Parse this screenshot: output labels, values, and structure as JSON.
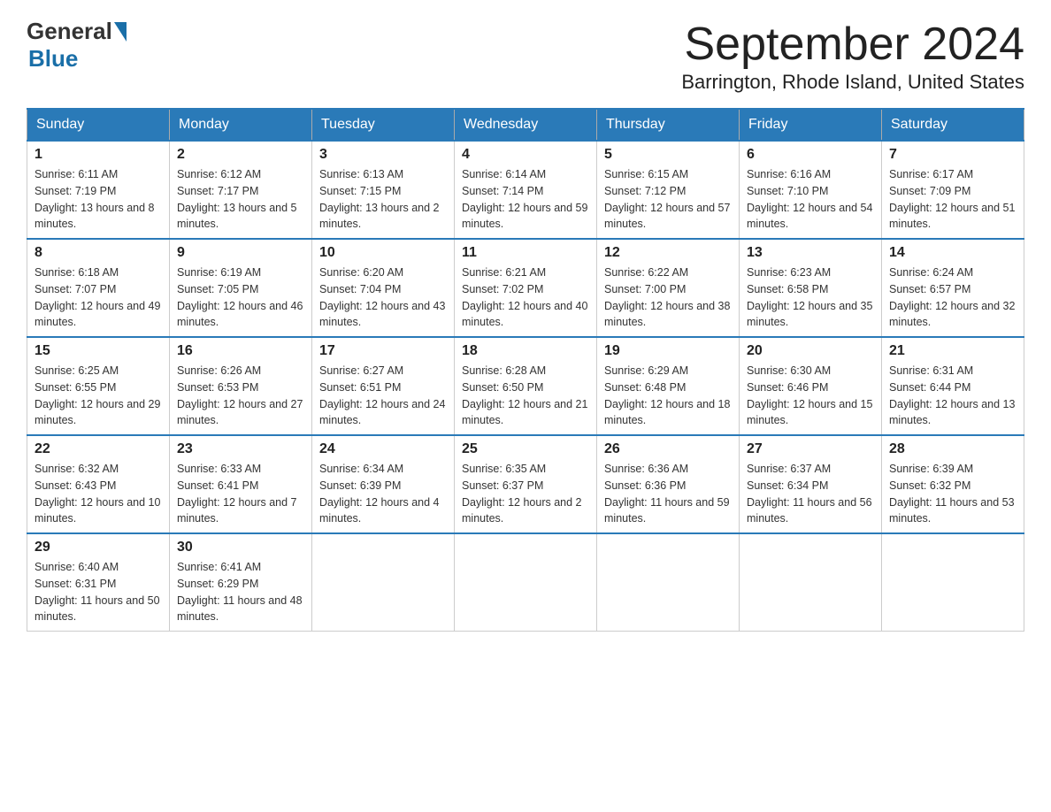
{
  "header": {
    "logo_general": "General",
    "logo_blue": "Blue",
    "month": "September 2024",
    "location": "Barrington, Rhode Island, United States"
  },
  "days_of_week": [
    "Sunday",
    "Monday",
    "Tuesday",
    "Wednesday",
    "Thursday",
    "Friday",
    "Saturday"
  ],
  "weeks": [
    [
      {
        "day": "1",
        "sunrise": "6:11 AM",
        "sunset": "7:19 PM",
        "daylight": "13 hours and 8 minutes."
      },
      {
        "day": "2",
        "sunrise": "6:12 AM",
        "sunset": "7:17 PM",
        "daylight": "13 hours and 5 minutes."
      },
      {
        "day": "3",
        "sunrise": "6:13 AM",
        "sunset": "7:15 PM",
        "daylight": "13 hours and 2 minutes."
      },
      {
        "day": "4",
        "sunrise": "6:14 AM",
        "sunset": "7:14 PM",
        "daylight": "12 hours and 59 minutes."
      },
      {
        "day": "5",
        "sunrise": "6:15 AM",
        "sunset": "7:12 PM",
        "daylight": "12 hours and 57 minutes."
      },
      {
        "day": "6",
        "sunrise": "6:16 AM",
        "sunset": "7:10 PM",
        "daylight": "12 hours and 54 minutes."
      },
      {
        "day": "7",
        "sunrise": "6:17 AM",
        "sunset": "7:09 PM",
        "daylight": "12 hours and 51 minutes."
      }
    ],
    [
      {
        "day": "8",
        "sunrise": "6:18 AM",
        "sunset": "7:07 PM",
        "daylight": "12 hours and 49 minutes."
      },
      {
        "day": "9",
        "sunrise": "6:19 AM",
        "sunset": "7:05 PM",
        "daylight": "12 hours and 46 minutes."
      },
      {
        "day": "10",
        "sunrise": "6:20 AM",
        "sunset": "7:04 PM",
        "daylight": "12 hours and 43 minutes."
      },
      {
        "day": "11",
        "sunrise": "6:21 AM",
        "sunset": "7:02 PM",
        "daylight": "12 hours and 40 minutes."
      },
      {
        "day": "12",
        "sunrise": "6:22 AM",
        "sunset": "7:00 PM",
        "daylight": "12 hours and 38 minutes."
      },
      {
        "day": "13",
        "sunrise": "6:23 AM",
        "sunset": "6:58 PM",
        "daylight": "12 hours and 35 minutes."
      },
      {
        "day": "14",
        "sunrise": "6:24 AM",
        "sunset": "6:57 PM",
        "daylight": "12 hours and 32 minutes."
      }
    ],
    [
      {
        "day": "15",
        "sunrise": "6:25 AM",
        "sunset": "6:55 PM",
        "daylight": "12 hours and 29 minutes."
      },
      {
        "day": "16",
        "sunrise": "6:26 AM",
        "sunset": "6:53 PM",
        "daylight": "12 hours and 27 minutes."
      },
      {
        "day": "17",
        "sunrise": "6:27 AM",
        "sunset": "6:51 PM",
        "daylight": "12 hours and 24 minutes."
      },
      {
        "day": "18",
        "sunrise": "6:28 AM",
        "sunset": "6:50 PM",
        "daylight": "12 hours and 21 minutes."
      },
      {
        "day": "19",
        "sunrise": "6:29 AM",
        "sunset": "6:48 PM",
        "daylight": "12 hours and 18 minutes."
      },
      {
        "day": "20",
        "sunrise": "6:30 AM",
        "sunset": "6:46 PM",
        "daylight": "12 hours and 15 minutes."
      },
      {
        "day": "21",
        "sunrise": "6:31 AM",
        "sunset": "6:44 PM",
        "daylight": "12 hours and 13 minutes."
      }
    ],
    [
      {
        "day": "22",
        "sunrise": "6:32 AM",
        "sunset": "6:43 PM",
        "daylight": "12 hours and 10 minutes."
      },
      {
        "day": "23",
        "sunrise": "6:33 AM",
        "sunset": "6:41 PM",
        "daylight": "12 hours and 7 minutes."
      },
      {
        "day": "24",
        "sunrise": "6:34 AM",
        "sunset": "6:39 PM",
        "daylight": "12 hours and 4 minutes."
      },
      {
        "day": "25",
        "sunrise": "6:35 AM",
        "sunset": "6:37 PM",
        "daylight": "12 hours and 2 minutes."
      },
      {
        "day": "26",
        "sunrise": "6:36 AM",
        "sunset": "6:36 PM",
        "daylight": "11 hours and 59 minutes."
      },
      {
        "day": "27",
        "sunrise": "6:37 AM",
        "sunset": "6:34 PM",
        "daylight": "11 hours and 56 minutes."
      },
      {
        "day": "28",
        "sunrise": "6:39 AM",
        "sunset": "6:32 PM",
        "daylight": "11 hours and 53 minutes."
      }
    ],
    [
      {
        "day": "29",
        "sunrise": "6:40 AM",
        "sunset": "6:31 PM",
        "daylight": "11 hours and 50 minutes."
      },
      {
        "day": "30",
        "sunrise": "6:41 AM",
        "sunset": "6:29 PM",
        "daylight": "11 hours and 48 minutes."
      },
      null,
      null,
      null,
      null,
      null
    ]
  ]
}
